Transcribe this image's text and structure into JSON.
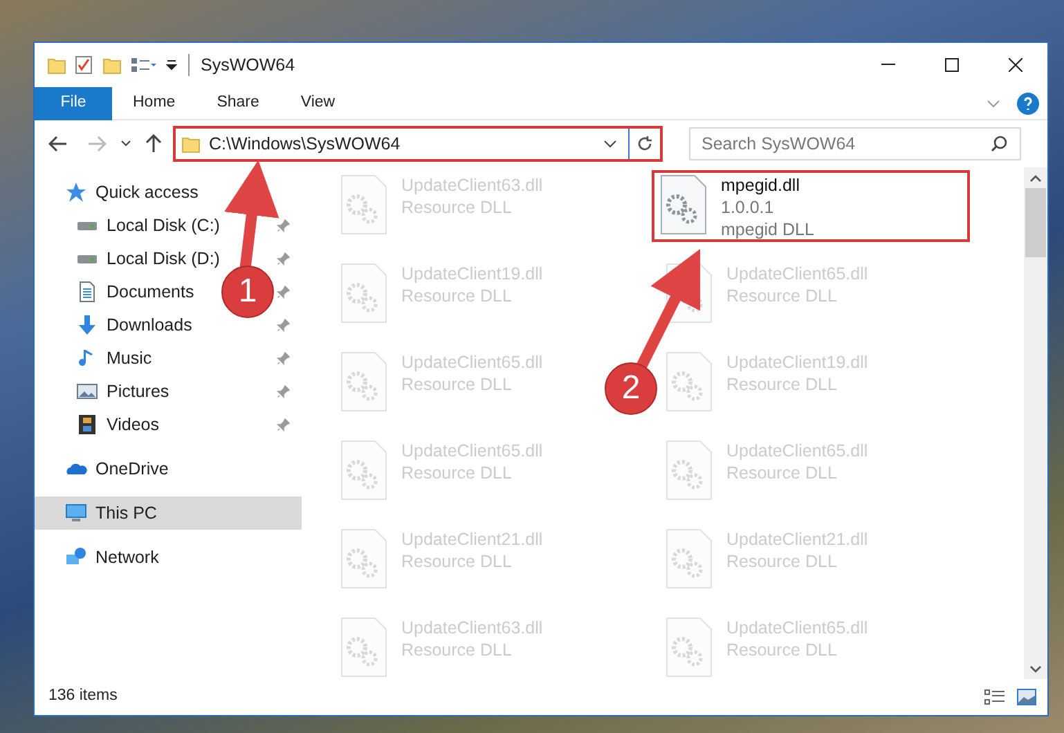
{
  "window": {
    "title": "SysWOW64"
  },
  "ribbon_tabs": [
    {
      "label": "File",
      "selected": true
    },
    {
      "label": "Home",
      "selected": false
    },
    {
      "label": "Share",
      "selected": false
    },
    {
      "label": "View",
      "selected": false
    }
  ],
  "address_bar": {
    "path": "C:\\Windows\\SysWOW64",
    "highlighted": true
  },
  "search": {
    "placeholder": "Search SysWOW64"
  },
  "sidebar": [
    {
      "label": "Quick access",
      "selected": false,
      "children": [
        {
          "label": "Local Disk (C:)",
          "pinned": true,
          "selected": false
        },
        {
          "label": "Local Disk (D:)",
          "pinned": true,
          "selected": false
        },
        {
          "label": "Documents",
          "pinned": true,
          "selected": false
        },
        {
          "label": "Downloads",
          "pinned": true,
          "selected": false
        },
        {
          "label": "Music",
          "pinned": true,
          "selected": false
        },
        {
          "label": "Pictures",
          "pinned": true,
          "selected": false
        },
        {
          "label": "Videos",
          "pinned": true,
          "selected": false
        }
      ]
    },
    {
      "label": "OneDrive",
      "selected": false
    },
    {
      "label": "This PC",
      "selected": true
    },
    {
      "label": "Network",
      "selected": false
    }
  ],
  "files": [
    {
      "name": "UpdateClient63.dll",
      "description": "Resource DLL",
      "blurred": true,
      "highlighted": false
    },
    {
      "name": "mpegid.dll",
      "version": "1.0.0.1",
      "description": "mpegid DLL",
      "blurred": false,
      "highlighted": true
    },
    {
      "name": "UpdateClient19.dll",
      "description": "Resource DLL",
      "blurred": true,
      "highlighted": false
    },
    {
      "name": "UpdateClient65.dll",
      "description": "Resource DLL",
      "blurred": true,
      "highlighted": false
    },
    {
      "name": "UpdateClient65.dll",
      "description": "Resource DLL",
      "blurred": true,
      "highlighted": false
    },
    {
      "name": "UpdateClient19.dll",
      "description": "Resource DLL",
      "blurred": true,
      "highlighted": false
    },
    {
      "name": "UpdateClient65.dll",
      "description": "Resource DLL",
      "blurred": true,
      "highlighted": false
    },
    {
      "name": "UpdateClient65.dll",
      "description": "Resource DLL",
      "blurred": true,
      "highlighted": false
    },
    {
      "name": "UpdateClient21.dll",
      "description": "Resource DLL",
      "blurred": true,
      "highlighted": false
    },
    {
      "name": "UpdateClient21.dll",
      "description": "Resource DLL",
      "blurred": true,
      "highlighted": false
    },
    {
      "name": "UpdateClient63.dll",
      "description": "Resource DLL",
      "blurred": true,
      "highlighted": false
    },
    {
      "name": "UpdateClient65.dll",
      "description": "Resource DLL",
      "blurred": true,
      "highlighted": false
    }
  ],
  "status_bar": {
    "item_count": "136 items"
  },
  "callouts": [
    {
      "number": "1"
    },
    {
      "number": "2"
    }
  ]
}
